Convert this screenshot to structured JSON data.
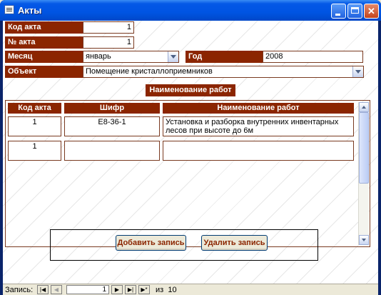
{
  "window": {
    "title": "Акты"
  },
  "form": {
    "kod_akta": {
      "label": "Код акта",
      "value": "1"
    },
    "nomer_akta": {
      "label": "№ акта",
      "value": "1"
    },
    "mesyac": {
      "label": "Месяц",
      "value": "январь"
    },
    "god": {
      "label": "Год",
      "value": "2008"
    },
    "obekt": {
      "label": "Объект",
      "value": "Помещение кристаллоприемников"
    },
    "section_title": "Наименование работ"
  },
  "table": {
    "headers": [
      "Код акта",
      "Шифр",
      "Наименование работ"
    ],
    "rows": [
      {
        "kod": "1",
        "shifr": "Е8-36-1",
        "naim": "Установка и разборка внутренних инвентарных лесов при высоте до 6м"
      },
      {
        "kod": "1",
        "shifr": "",
        "naim": ""
      }
    ]
  },
  "buttons": {
    "add": "Добавить запись",
    "delete": "Удалить запись"
  },
  "navigation": {
    "label": "Запись:",
    "current": "1",
    "of_label": "из",
    "total": "10"
  },
  "colors": {
    "label_bg": "#8b2500",
    "titlebar": "#0054e3"
  }
}
